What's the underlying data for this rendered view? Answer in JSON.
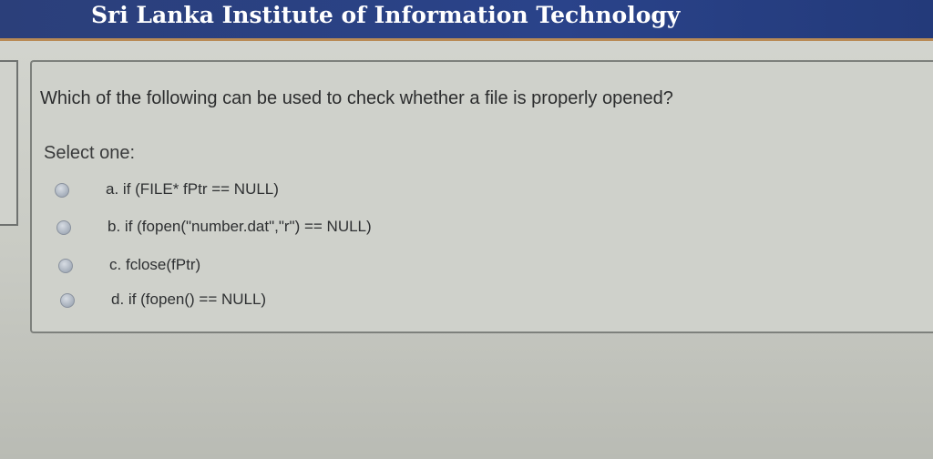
{
  "header": {
    "title": "Sri Lanka Institute of Information Technology"
  },
  "question": {
    "text": "Which of the following can be used to check whether a file is properly opened?",
    "select_label": "Select one:",
    "options": [
      {
        "letter": "a.",
        "text": "if (FILE* fPtr == NULL)"
      },
      {
        "letter": "b.",
        "text": "if (fopen(\"number.dat\",\"r\") == NULL)"
      },
      {
        "letter": "c.",
        "text": "fclose(fPtr)"
      },
      {
        "letter": "d.",
        "text": "if (fopen() == NULL)"
      }
    ]
  },
  "colors": {
    "header_bg": "#2a438a",
    "accent": "#b98a55",
    "page_bg": "#cfd1cb"
  }
}
